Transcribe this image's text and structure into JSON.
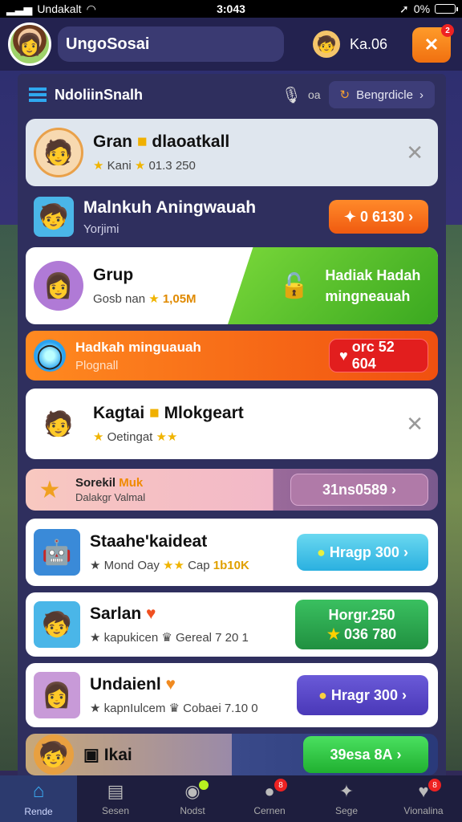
{
  "status": {
    "carrier": "Undakalt",
    "time": "3:043",
    "battery": "0%"
  },
  "header": {
    "username": "UngoSosai",
    "coins": "Ka.06",
    "action_badge": "2"
  },
  "panel": {
    "title": "NdoliinSnalh",
    "filter_label": "oa",
    "sort_label": "Bengrdicle"
  },
  "cards": [
    {
      "title": "Gran",
      "title2": "dlaoatkall",
      "subtitle": "Kani",
      "subtitle2": "01.3 250"
    },
    {
      "title": "Malnkuh Aningwauah",
      "subtitle": "Yorjimi",
      "button": "0 6130"
    },
    {
      "title": "Grup",
      "subtitle": "Gosb nan",
      "subtitle2": "1,05M",
      "banner_line1": "Hadiak Hadah",
      "banner_line2": "mingneauah"
    },
    {
      "title": "Hadkah minguauah",
      "subtitle": "Plognall",
      "button": "orc 52 604"
    },
    {
      "title": "Kagtai",
      "title2": "Mlokgeart",
      "subtitle": "Oetingat"
    },
    {
      "title": "Sorekil",
      "title_accent": "Muk",
      "subtitle": "Dalakgr Valmal",
      "button": "31ns0589"
    },
    {
      "title": "Staahe'kaideat",
      "subtitle": "Mond Oay",
      "subtitle2": "Cap",
      "subtitle3": "1b10K",
      "button": "Hragp 300"
    },
    {
      "title": "Sarlan",
      "subtitle": "kapukicen",
      "subtitle2": "Gereal 7 20 1",
      "button_line1": "Horgr.250",
      "button_line2": "036 780"
    },
    {
      "title": "Undaienl",
      "subtitle": "kapnIulcem",
      "subtitle2": "Cobaei 7.10 0",
      "button": "Hragr 300"
    },
    {
      "title": "Ikai",
      "button": "39esa 8A"
    }
  ],
  "nav": [
    {
      "label": "Rende",
      "icon": "home-icon"
    },
    {
      "label": "Sesen",
      "icon": "chest-icon"
    },
    {
      "label": "Nodst",
      "icon": "vinyl-icon"
    },
    {
      "label": "Cernen",
      "icon": "ball-icon",
      "badge": "8"
    },
    {
      "label": "Sege",
      "icon": "star-icon"
    },
    {
      "label": "Vionalina",
      "icon": "heart-icon",
      "badge": "8"
    }
  ]
}
